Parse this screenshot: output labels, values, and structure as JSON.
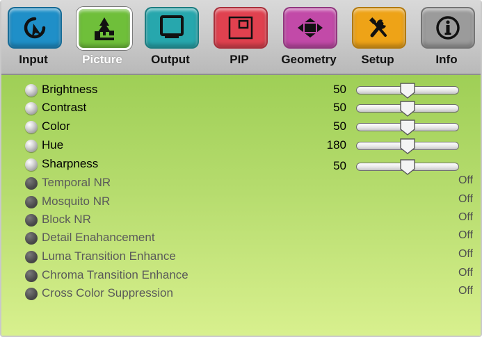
{
  "tabs": [
    {
      "label": "Input",
      "icon": "input-return-icon",
      "color": "#1f8fc8",
      "selected": false
    },
    {
      "label": "Picture",
      "icon": "landscape-picture-icon",
      "color": "#6fbf3a",
      "selected": true
    },
    {
      "label": "Output",
      "icon": "monitor-icon",
      "color": "#27a7ad",
      "selected": false
    },
    {
      "label": "PIP",
      "icon": "picture-in-picture-icon",
      "color": "#e0414f",
      "selected": false
    },
    {
      "label": "Geometry",
      "icon": "rotated-rectangle-icon",
      "color": "#c24aa8",
      "selected": false
    },
    {
      "label": "Setup",
      "icon": "tools-icon",
      "color": "#eea317",
      "selected": false
    },
    {
      "label": "Info",
      "icon": "info-icon",
      "color": "#9b9b9b",
      "selected": false
    }
  ],
  "adjustments": [
    {
      "label": "Brightness",
      "value": "50",
      "level": 0.5
    },
    {
      "label": "Contrast",
      "value": "50",
      "level": 0.5
    },
    {
      "label": "Color",
      "value": "50",
      "level": 0.5
    },
    {
      "label": "Hue",
      "value": "180",
      "level": 0.5
    },
    {
      "label": "Sharpness",
      "value": "50",
      "level": 0.5
    }
  ],
  "toggles": [
    {
      "label": "Temporal NR",
      "state": "Off"
    },
    {
      "label": "Mosquito NR",
      "state": "Off"
    },
    {
      "label": "Block NR",
      "state": "Off"
    },
    {
      "label": "Detail Enahancement",
      "state": "Off"
    },
    {
      "label": "Luma Transition Enhance",
      "state": "Off"
    },
    {
      "label": "Chroma Transition Enhance",
      "state": "Off"
    },
    {
      "label": "Cross Color Suppression",
      "state": "Off"
    }
  ]
}
